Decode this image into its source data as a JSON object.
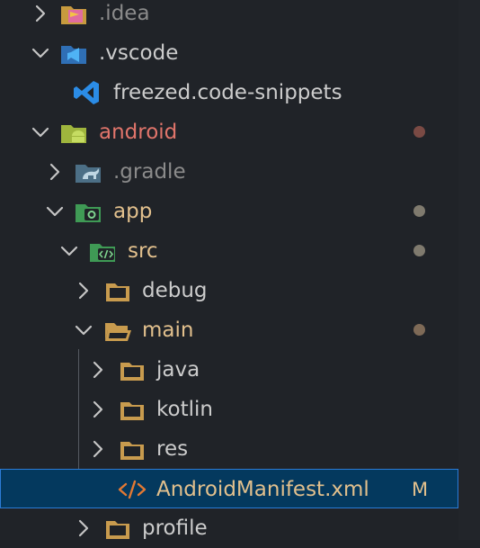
{
  "colors": {
    "background": "#202328",
    "selection": "#04395e",
    "selection_border": "#2b7bd6",
    "text": "#cccccc",
    "ignored_text": "#8b8b8b",
    "modified_text": "#e2c08d",
    "modified_dot": "#7e6a57",
    "untracked_text": "#e1756b",
    "untracked_dot": "#7a4a44",
    "dot_gray": "#7f7a6e"
  },
  "tree": {
    "items": [
      {
        "label": ".idea",
        "icon": "idea-folder-icon",
        "expanded": false,
        "status": "ignored"
      },
      {
        "label": ".vscode",
        "icon": "vscode-folder-icon",
        "expanded": true,
        "status": "normal"
      },
      {
        "label": "freezed.code-snippets",
        "icon": "vscode-file-icon",
        "status": "normal"
      },
      {
        "label": "android",
        "icon": "android-folder-icon",
        "expanded": true,
        "status": "untracked"
      },
      {
        "label": ".gradle",
        "icon": "gradle-folder-icon",
        "expanded": false,
        "status": "ignored"
      },
      {
        "label": "app",
        "icon": "app-folder-icon",
        "expanded": true,
        "status": "modified"
      },
      {
        "label": "src",
        "icon": "src-folder-icon",
        "expanded": true,
        "status": "modified"
      },
      {
        "label": "debug",
        "icon": "folder-icon",
        "expanded": false,
        "status": "normal"
      },
      {
        "label": "main",
        "icon": "folder-open-icon",
        "expanded": true,
        "status": "modified"
      },
      {
        "label": "java",
        "icon": "folder-icon",
        "expanded": false,
        "status": "normal"
      },
      {
        "label": "kotlin",
        "icon": "folder-icon",
        "expanded": false,
        "status": "normal"
      },
      {
        "label": "res",
        "icon": "folder-icon",
        "expanded": false,
        "status": "normal"
      },
      {
        "label": "AndroidManifest.xml",
        "icon": "xml-file-icon",
        "status": "modified",
        "badge": "M",
        "selected": true
      },
      {
        "label": "profile",
        "icon": "folder-icon",
        "expanded": false,
        "status": "normal"
      }
    ]
  }
}
